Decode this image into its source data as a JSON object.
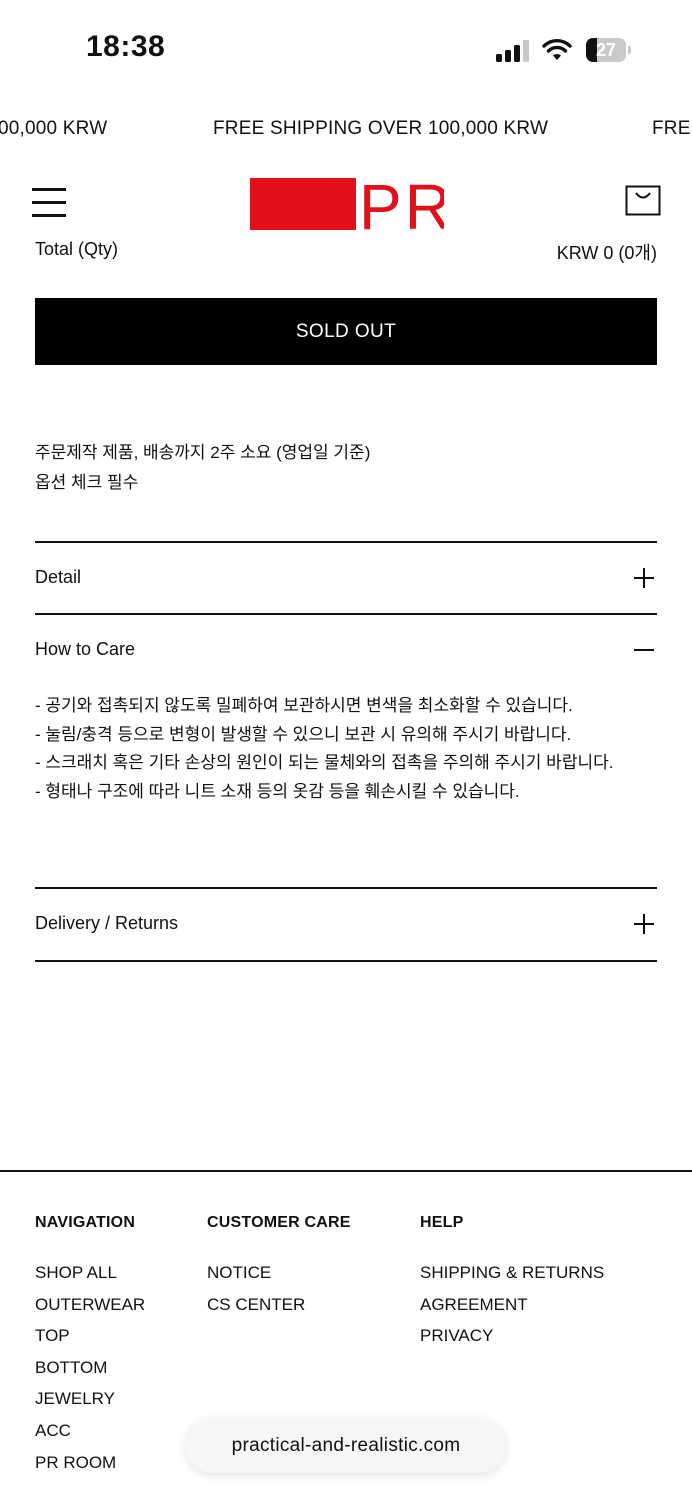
{
  "status_bar": {
    "time": "18:38",
    "battery": "27",
    "battery_level": 0.27
  },
  "marquee": {
    "text": "FREE SHIPPING OVER 100,000 KRW",
    "left_fragment": "00,000 KRW",
    "right_fragment": "FRE"
  },
  "header": {
    "logo_text": "PR",
    "brand_color": "#e2101b"
  },
  "product": {
    "total_label": "Total (Qty)",
    "total_value": "KRW 0 (0개)",
    "sold_out_label": "SOLD OUT",
    "notes": [
      "주문제작 제품, 배송까지 2주 소요 (영업일 기준)",
      "옵션 체크 필수"
    ]
  },
  "accordion": {
    "detail": {
      "title": "Detail",
      "icon": "plus-icon"
    },
    "care": {
      "title": "How to Care",
      "icon": "minus-icon",
      "lines": [
        "- 공기와 접촉되지 않도록 밀폐하여 보관하시면 변색을 최소화할 수 있습니다.",
        "- 눌림/충격 등으로 변형이 발생할 수 있으니 보관 시 유의해 주시기 바랍니다.",
        "- 스크래치 혹은 기타 손상의 원인이 되는 물체와의 접촉을 주의해 주시기 바랍니다.",
        "- 형태나 구조에 따라 니트 소재 등의 옷감 등을 훼손시킬 수 있습니다."
      ]
    },
    "delivery": {
      "title": "Delivery / Returns",
      "icon": "plus-icon"
    }
  },
  "footer": {
    "navigation": {
      "heading": "NAVIGATION",
      "links": [
        "SHOP ALL",
        "OUTERWEAR",
        "TOP",
        "BOTTOM",
        "JEWELRY",
        "ACC",
        "PR ROOM"
      ]
    },
    "customer_care": {
      "heading": "CUSTOMER CARE",
      "links": [
        "NOTICE",
        "CS CENTER"
      ]
    },
    "help": {
      "heading": "HELP",
      "links": [
        "SHIPPING & RETURNS",
        "AGREEMENT",
        "PRIVACY"
      ]
    }
  },
  "browser": {
    "url": "practical-and-realistic.com"
  }
}
